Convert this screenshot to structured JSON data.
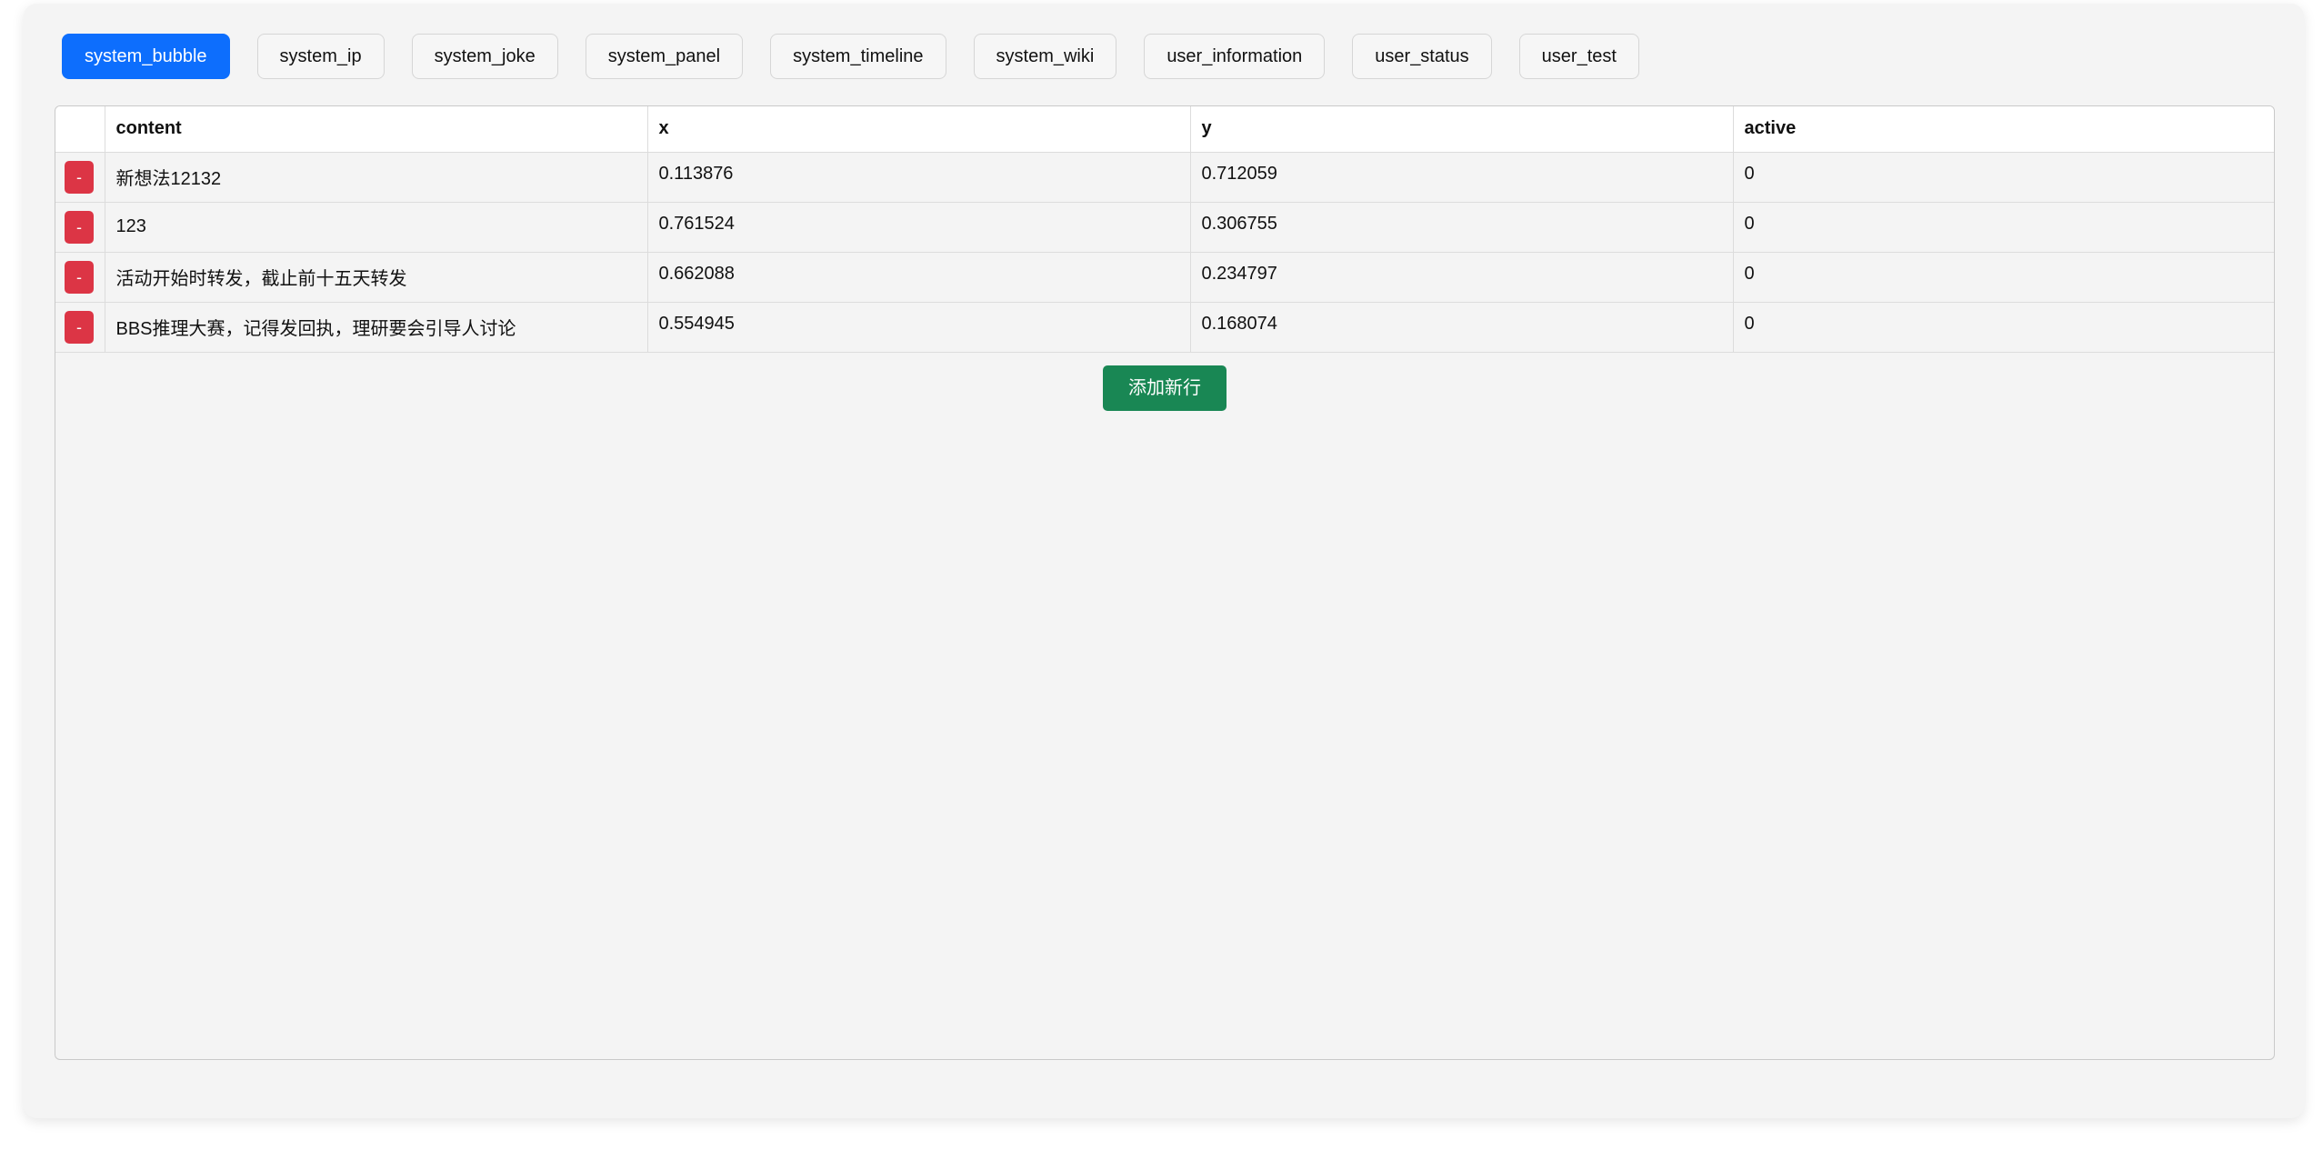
{
  "tabs": [
    {
      "label": "system_bubble",
      "active": true
    },
    {
      "label": "system_ip",
      "active": false
    },
    {
      "label": "system_joke",
      "active": false
    },
    {
      "label": "system_panel",
      "active": false
    },
    {
      "label": "system_timeline",
      "active": false
    },
    {
      "label": "system_wiki",
      "active": false
    },
    {
      "label": "user_information",
      "active": false
    },
    {
      "label": "user_status",
      "active": false
    },
    {
      "label": "user_test",
      "active": false
    }
  ],
  "table": {
    "columns": [
      "content",
      "x",
      "y",
      "active"
    ],
    "rows": [
      {
        "delete_label": "-",
        "content": "新想法12132",
        "x": "0.113876",
        "y": "0.712059",
        "active": "0"
      },
      {
        "delete_label": "-",
        "content": "123",
        "x": "0.761524",
        "y": "0.306755",
        "active": "0"
      },
      {
        "delete_label": "-",
        "content": "活动开始时转发，截止前十五天转发",
        "x": "0.662088",
        "y": "0.234797",
        "active": "0"
      },
      {
        "delete_label": "-",
        "content": "BBS推理大赛，记得发回执，理研要会引导人讨论",
        "x": "0.554945",
        "y": "0.168074",
        "active": "0"
      }
    ]
  },
  "add_row_label": "添加新行",
  "colors": {
    "active_tab": "#0d6efd",
    "delete_button": "#dc3545",
    "add_button": "#198754"
  }
}
